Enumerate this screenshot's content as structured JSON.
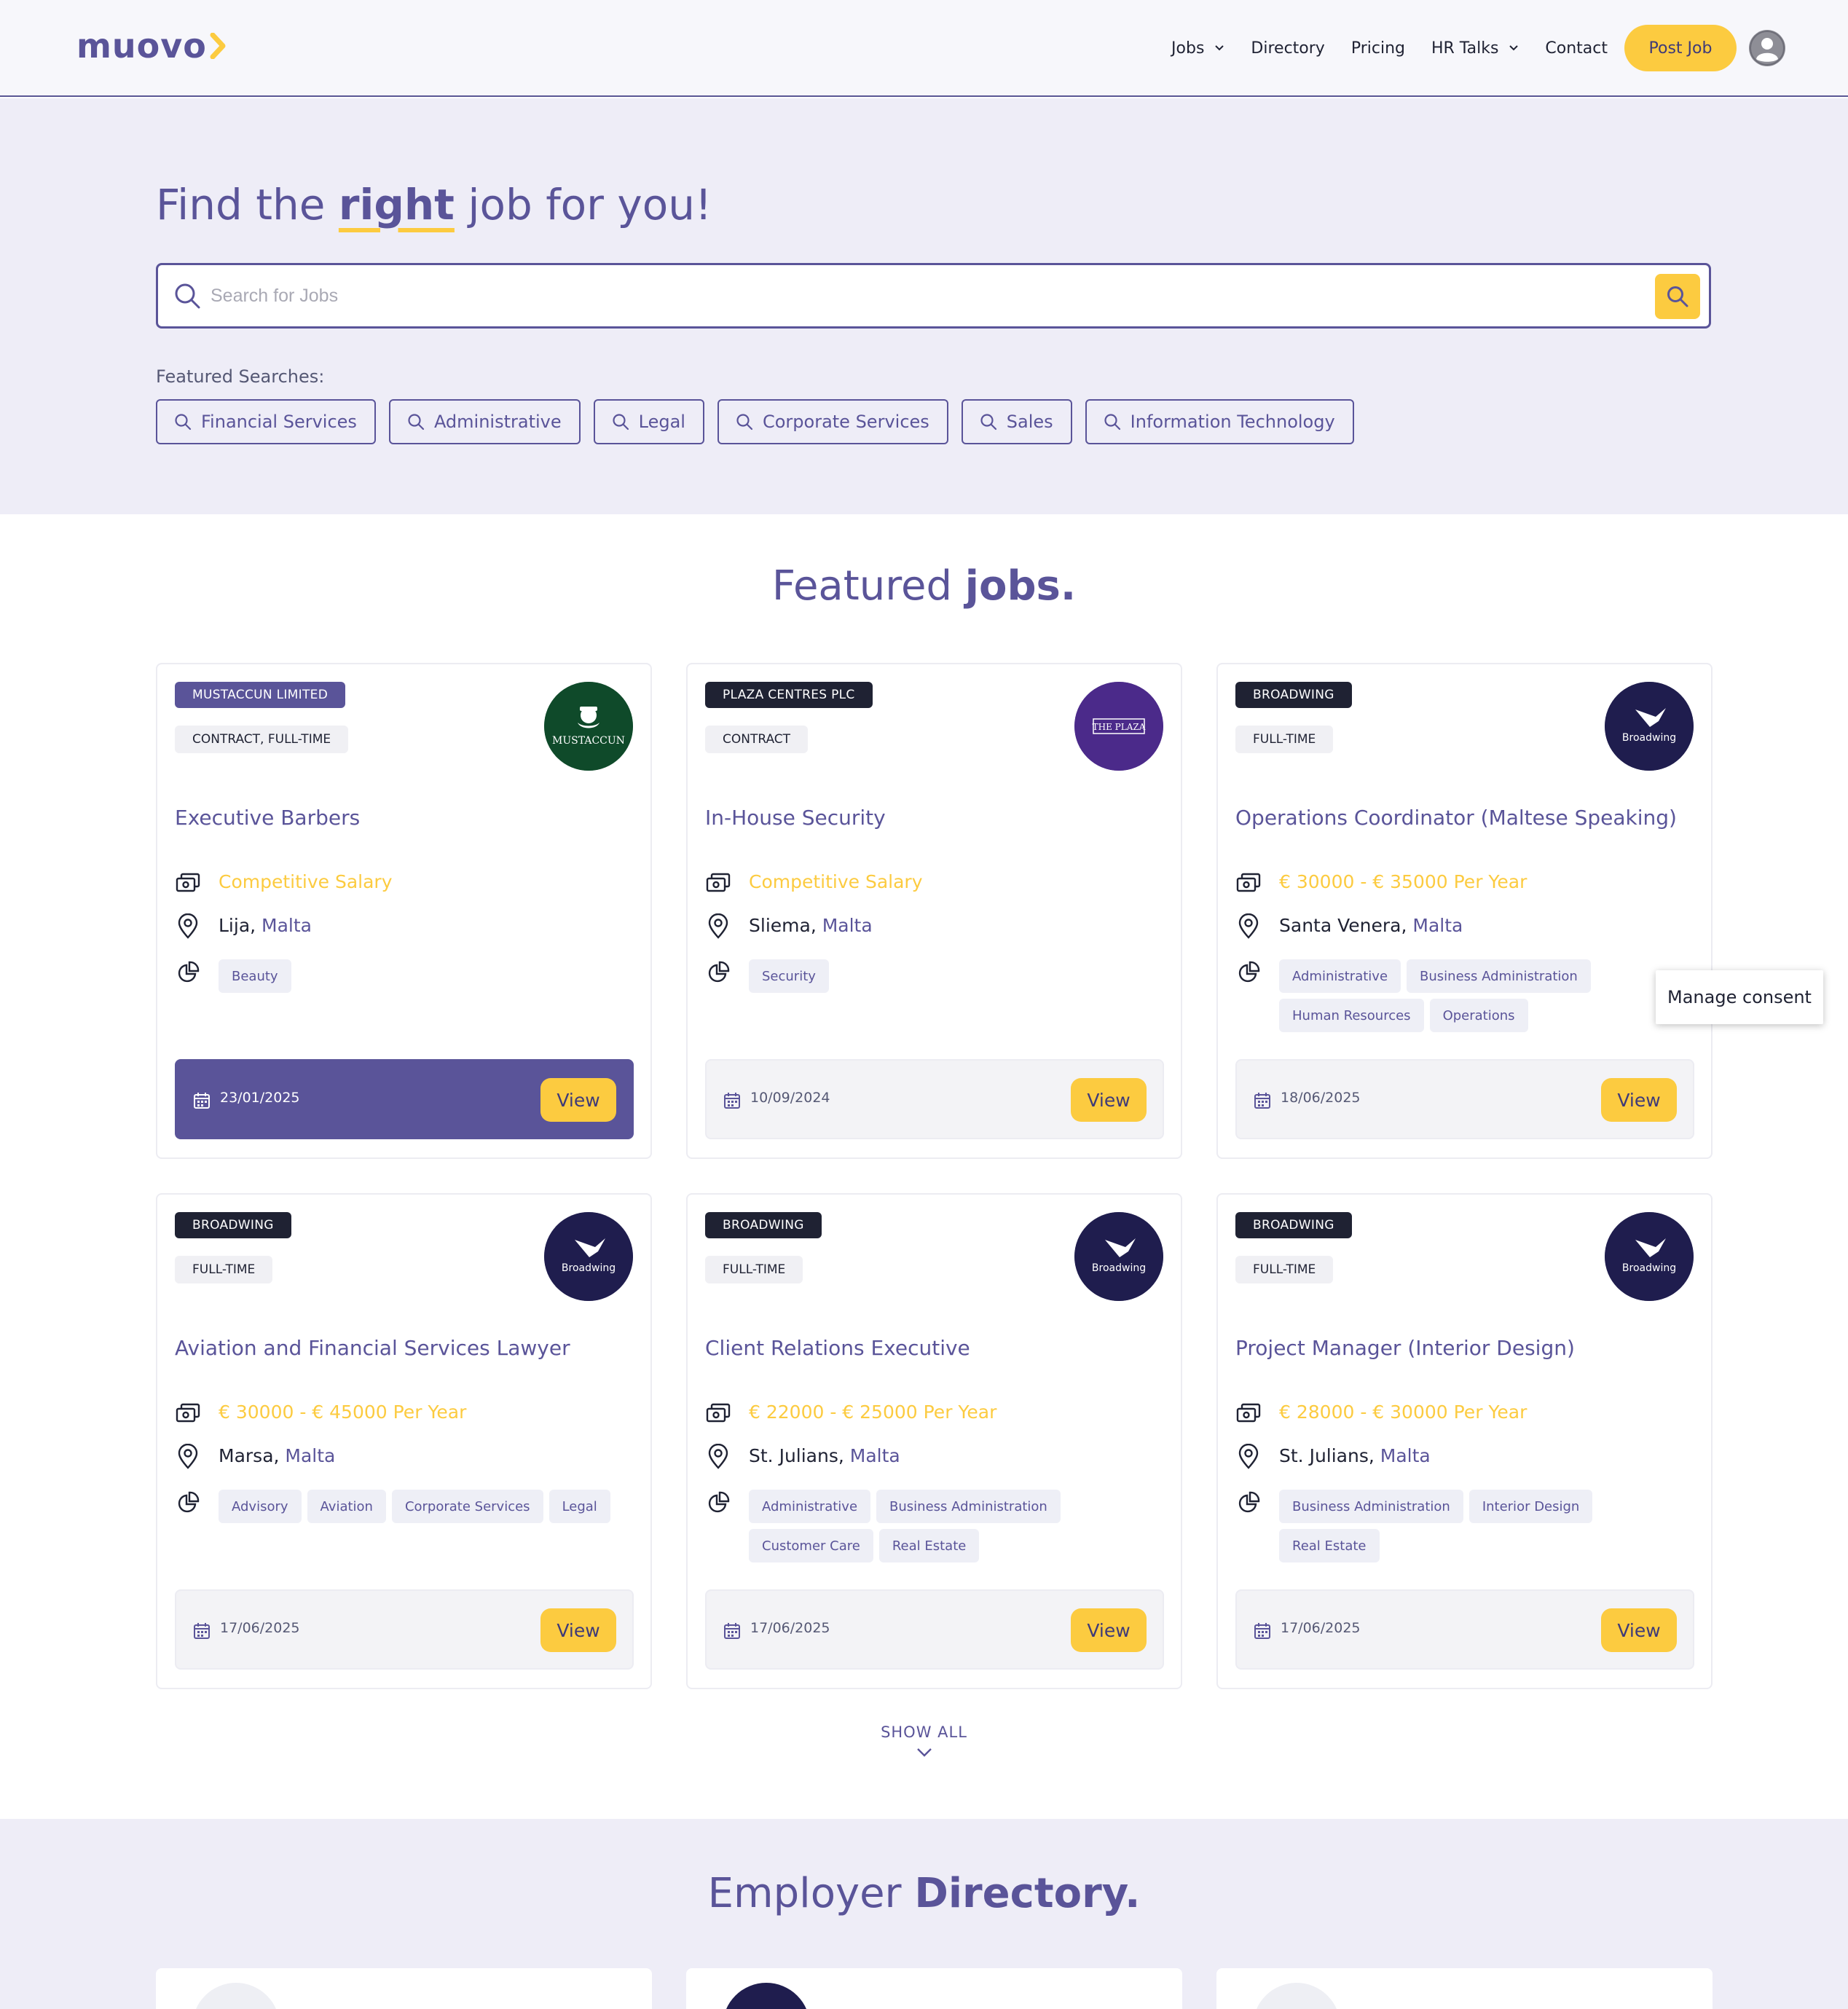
{
  "brand": {
    "name": "muovo",
    "accent": "#fccb40",
    "primary": "#5a5499"
  },
  "nav": {
    "items": [
      {
        "label": "Jobs",
        "dropdown": true
      },
      {
        "label": "Directory",
        "dropdown": false
      },
      {
        "label": "Pricing",
        "dropdown": false
      },
      {
        "label": "HR Talks",
        "dropdown": true
      },
      {
        "label": "Contact",
        "dropdown": false
      }
    ],
    "post_job": "Post Job",
    "avatar_icon": "user-avatar-icon"
  },
  "hero": {
    "title_before": "Find the ",
    "title_emph": "right",
    "title_after": " job for you!",
    "search_placeholder": "Search for Jobs",
    "search_value": "",
    "featured_label": "Featured Searches:",
    "featured_searches": [
      "Financial Services",
      "Administrative",
      "Legal",
      "Corporate Services",
      "Sales",
      "Information Technology"
    ]
  },
  "featured": {
    "title_regular": "Featured ",
    "title_bold": "jobs.",
    "jobs": [
      {
        "company": "MUSTACCUN LIMITED",
        "type": "CONTRACT, FULL-TIME",
        "title": "Executive Barbers",
        "salary": "Competitive Salary",
        "city": "Lija, ",
        "country": "Malta",
        "tags": [
          "Beauty"
        ],
        "date": "23/01/2025",
        "view": "View",
        "logo_text": "MUSTACCUN",
        "logo_bg": "#0f4a2a"
      },
      {
        "company": "PLAZA CENTRES PLC",
        "type": "CONTRACT",
        "title": "In-House Security",
        "salary": "Competitive Salary",
        "city": "Sliema, ",
        "country": "Malta",
        "tags": [
          "Security"
        ],
        "date": "10/09/2024",
        "view": "View",
        "logo_text": "THE PLAZA",
        "logo_bg": "#4b2a8a"
      },
      {
        "company": "BROADWING",
        "type": "FULL-TIME",
        "title": "Operations Coordinator (Maltese Speaking)",
        "salary": "€ 30000 - € 35000 Per Year",
        "city": "Santa Venera, ",
        "country": "Malta",
        "tags": [
          "Administrative",
          "Business Administration",
          "Human Resources",
          "Operations"
        ],
        "date": "18/06/2025",
        "view": "View",
        "logo_text": "Broadwing",
        "logo_bg": "#1f1d4e"
      },
      {
        "company": "BROADWING",
        "type": "FULL-TIME",
        "title": "Aviation and Financial Services Lawyer",
        "salary": "€ 30000 - € 45000 Per Year",
        "city": "Marsa, ",
        "country": "Malta",
        "tags": [
          "Advisory",
          "Aviation",
          "Corporate Services",
          "Legal"
        ],
        "date": "17/06/2025",
        "view": "View",
        "logo_text": "Broadwing",
        "logo_bg": "#1f1d4e"
      },
      {
        "company": "BROADWING",
        "type": "FULL-TIME",
        "title": "Client Relations Executive",
        "salary": "€ 22000 - € 25000 Per Year",
        "city": "St. Julians, ",
        "country": "Malta",
        "tags": [
          "Administrative",
          "Business Administration",
          "Customer Care",
          "Real Estate"
        ],
        "date": "17/06/2025",
        "view": "View",
        "logo_text": "Broadwing",
        "logo_bg": "#1f1d4e"
      },
      {
        "company": "BROADWING",
        "type": "FULL-TIME",
        "title": "Project Manager (Interior Design)",
        "salary": "€ 28000 - € 30000 Per Year",
        "city": "St. Julians, ",
        "country": "Malta",
        "tags": [
          "Business Administration",
          "Interior Design",
          "Real Estate"
        ],
        "date": "17/06/2025",
        "view": "View",
        "logo_text": "Broadwing",
        "logo_bg": "#1f1d4e"
      }
    ],
    "show_all": "SHOW ALL"
  },
  "consent": {
    "label": "Manage consent"
  },
  "directory": {
    "title_regular": "Employer ",
    "title_bold": "Directory."
  }
}
